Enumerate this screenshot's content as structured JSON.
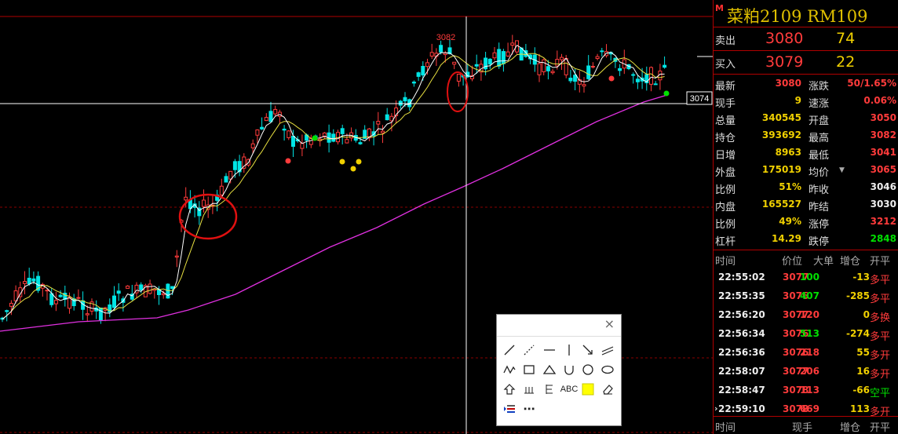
{
  "chart": {
    "high_label": "3082",
    "price_tag": "3074"
  },
  "header": {
    "marker": "M",
    "title": "菜粕2109  RM109"
  },
  "orderbook": [
    {
      "label": "卖出",
      "price": "3080",
      "volume": "74"
    },
    {
      "label": "买入",
      "price": "3079",
      "volume": "22"
    }
  ],
  "quote": [
    {
      "l1": "最新",
      "v1": "3080",
      "c1": "red",
      "l2": "涨跌",
      "v2": "50/1.65%",
      "c2": "red"
    },
    {
      "l1": "现手",
      "v1": "9",
      "c1": "yellow",
      "l2": "速涨",
      "v2": "0.06%",
      "c2": "red"
    },
    {
      "l1": "总量",
      "v1": "340545",
      "c1": "yellow",
      "l2": "开盘",
      "v2": "3050",
      "c2": "red"
    },
    {
      "l1": "持仓",
      "v1": "393692",
      "c1": "yellow",
      "l2": "最高",
      "v2": "3082",
      "c2": "red"
    },
    {
      "l1": "日增",
      "v1": "8963",
      "c1": "yellow",
      "l2": "最低",
      "v2": "3041",
      "c2": "red"
    },
    {
      "l1": "外盘",
      "v1": "175019",
      "c1": "yellow",
      "l2": "均价",
      "v2": "3065",
      "c2": "red"
    },
    {
      "l1": "比例",
      "v1": "51%",
      "c1": "yellow",
      "l2": "昨收",
      "v2": "3046",
      "c2": "white"
    },
    {
      "l1": "内盘",
      "v1": "165527",
      "c1": "yellow",
      "l2": "昨结",
      "v2": "3030",
      "c2": "white"
    },
    {
      "l1": "比例",
      "v1": "49%",
      "c1": "yellow",
      "l2": "涨停",
      "v2": "3212",
      "c2": "red"
    },
    {
      "l1": "杠杆",
      "v1": "14.29",
      "c1": "yellow",
      "l2": "跌停",
      "v2": "2848",
      "c2": "green"
    }
  ],
  "ticks_header": {
    "time": "时间",
    "price": "价位",
    "volume": "大单",
    "oi": "增仓",
    "type": "开平"
  },
  "ticks": [
    {
      "time": "22:55:02",
      "price": "3077",
      "volume": "100",
      "vc": "green",
      "oi": "-13",
      "type": "多平"
    },
    {
      "time": "22:55:35",
      "price": "3076",
      "volume": "407",
      "vc": "green",
      "oi": "-285",
      "type": "多平"
    },
    {
      "time": "22:56:20",
      "price": "3077",
      "volume": "120",
      "vc": "red",
      "oi": "0",
      "type": "多换"
    },
    {
      "time": "22:56:34",
      "price": "3076",
      "volume": "513",
      "vc": "green",
      "oi": "-274",
      "type": "多平"
    },
    {
      "time": "22:56:36",
      "price": "3076",
      "volume": "218",
      "vc": "red",
      "oi": "55",
      "type": "多开"
    },
    {
      "time": "22:58:07",
      "price": "3077",
      "volume": "206",
      "vc": "red",
      "oi": "16",
      "type": "多开"
    },
    {
      "time": "22:58:47",
      "price": "3078",
      "volume": "113",
      "vc": "red",
      "oi": "-66",
      "type": "空平"
    },
    {
      "time": "22:59:10",
      "price": "3078",
      "volume": "669",
      "vc": "red",
      "oi": "113",
      "type": "多开"
    }
  ],
  "ticks_footer": {
    "time": "时间",
    "hand": "现手",
    "oi": "增仓",
    "type": "开平"
  },
  "tools": {
    "text_tool_label": "ABC",
    "more_label": "⋯",
    "close_label": "×"
  }
}
